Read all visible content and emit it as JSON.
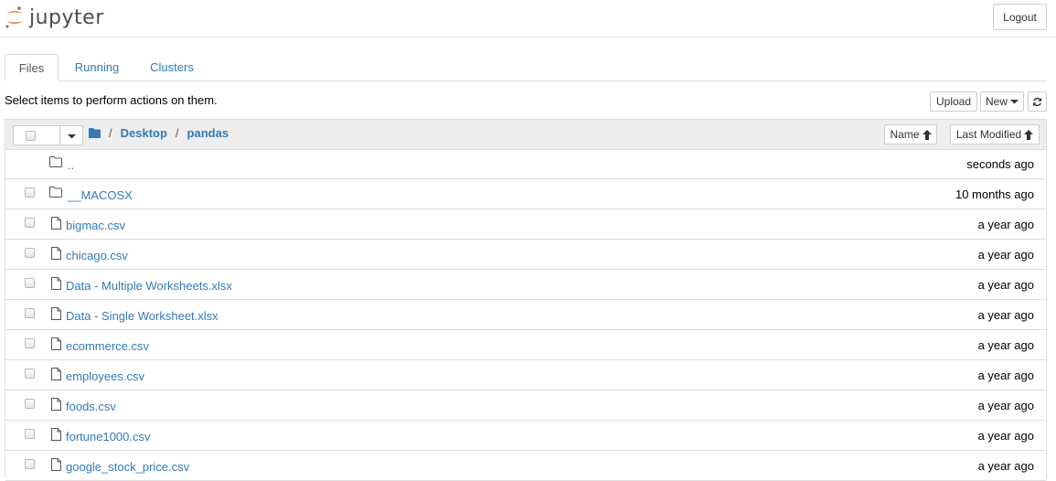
{
  "header": {
    "logo_text": "jupyter",
    "logout_label": "Logout",
    "brand_color": "#f37726"
  },
  "tabs": [
    {
      "label": "Files",
      "active": true
    },
    {
      "label": "Running",
      "active": false
    },
    {
      "label": "Clusters",
      "active": false
    }
  ],
  "toolbar": {
    "instructions": "Select items to perform actions on them.",
    "upload_label": "Upload",
    "new_label": "New",
    "refresh_icon": "refresh-icon"
  },
  "breadcrumb": {
    "root_icon": "folder-icon",
    "separator": "/",
    "items": [
      "Desktop",
      "pandas"
    ]
  },
  "sort": {
    "name_label": "Name",
    "modified_label": "Last Modified",
    "arrow_icon": "arrow-up-icon"
  },
  "files": [
    {
      "name": "..",
      "type": "folder",
      "modified": "seconds ago",
      "checkbox": false
    },
    {
      "name": "__MACOSX",
      "type": "folder",
      "modified": "10 months ago",
      "checkbox": true
    },
    {
      "name": "bigmac.csv",
      "type": "file",
      "modified": "a year ago",
      "checkbox": true
    },
    {
      "name": "chicago.csv",
      "type": "file",
      "modified": "a year ago",
      "checkbox": true
    },
    {
      "name": "Data - Multiple Worksheets.xlsx",
      "type": "file",
      "modified": "a year ago",
      "checkbox": true
    },
    {
      "name": "Data - Single Worksheet.xlsx",
      "type": "file",
      "modified": "a year ago",
      "checkbox": true
    },
    {
      "name": "ecommerce.csv",
      "type": "file",
      "modified": "a year ago",
      "checkbox": true
    },
    {
      "name": "employees.csv",
      "type": "file",
      "modified": "a year ago",
      "checkbox": true
    },
    {
      "name": "foods.csv",
      "type": "file",
      "modified": "a year ago",
      "checkbox": true
    },
    {
      "name": "fortune1000.csv",
      "type": "file",
      "modified": "a year ago",
      "checkbox": true
    },
    {
      "name": "google_stock_price.csv",
      "type": "file",
      "modified": "a year ago",
      "checkbox": true
    }
  ]
}
